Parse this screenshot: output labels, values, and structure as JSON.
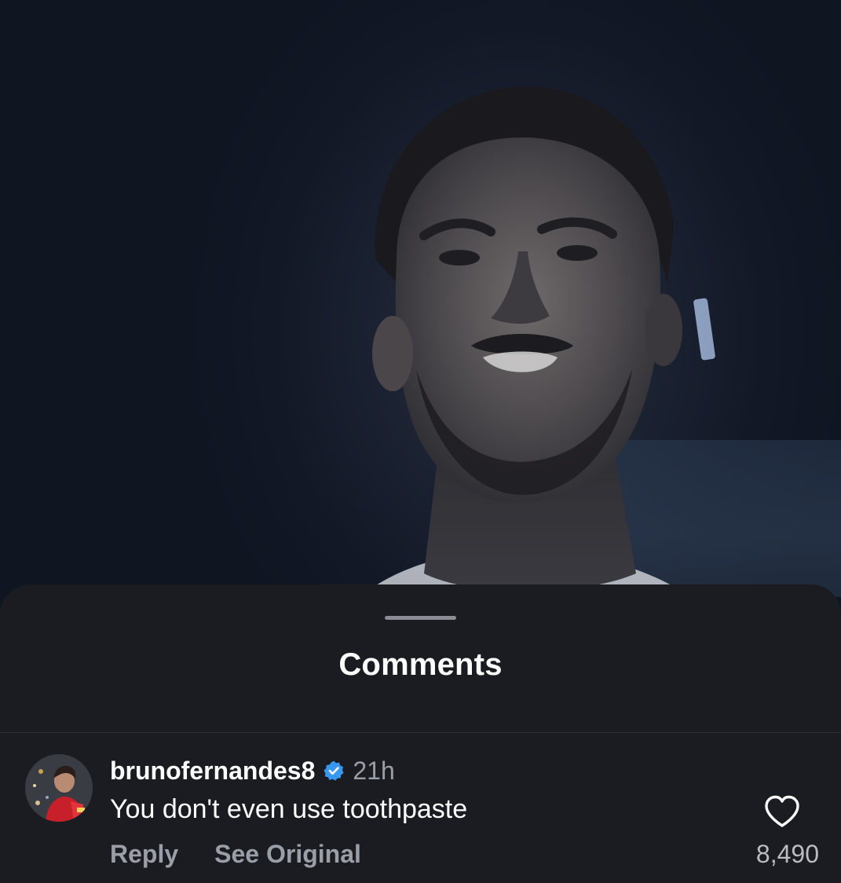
{
  "video": {
    "description_icon": "person-video-frame"
  },
  "sheet": {
    "title": "Comments"
  },
  "comment": {
    "username": "brunofernandes8",
    "verified": true,
    "time": "21h",
    "text": "You don't even use toothpaste",
    "reply_label": "Reply",
    "see_original_label": "See Original",
    "like_count": "8,490"
  },
  "colors": {
    "sheet_bg": "#1a1c21",
    "verified_blue": "#3897f0",
    "secondary_text": "#9a9ea6"
  },
  "icons": {
    "verified": "verified-badge-icon",
    "like": "heart-outline-icon",
    "avatar": "avatar-photo"
  }
}
